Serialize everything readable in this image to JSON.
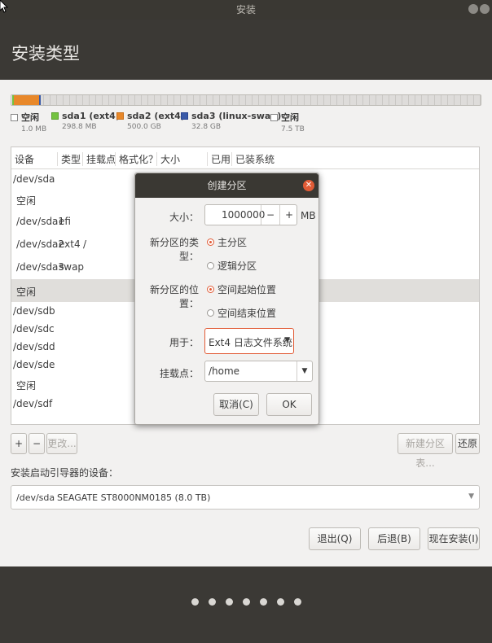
{
  "window": {
    "title": "安装"
  },
  "header": {
    "title": "安装类型"
  },
  "partitions": {
    "legend": [
      {
        "name": "空闲",
        "size": "1.0 MB",
        "color": "#ffffff"
      },
      {
        "name": "sda1 (ext4)",
        "size": "298.8 MB",
        "color": "#73c23f"
      },
      {
        "name": "sda2 (ext4)",
        "size": "500.0 GB",
        "color": "#e8882a"
      },
      {
        "name": "sda3 (linux-swap)",
        "size": "32.8 GB",
        "color": "#3a5aa8"
      },
      {
        "name": "空闲",
        "size": "7.5 TB",
        "color": "#ffffff"
      }
    ]
  },
  "table": {
    "headers": [
      "设备",
      "类型",
      "挂载点",
      "格式化？",
      "大小",
      "已用",
      "已装系统"
    ],
    "rows": [
      {
        "device": "/dev/sda",
        "type": "",
        "mount": ""
      },
      {
        "device": "空闲",
        "type": "",
        "mount": ""
      },
      {
        "device": "/dev/sda1",
        "type": "efi",
        "mount": ""
      },
      {
        "device": "/dev/sda2",
        "type": "ext4",
        "mount": "/"
      },
      {
        "device": "/dev/sda3",
        "type": "swap",
        "mount": ""
      },
      {
        "device": "空闲",
        "type": "",
        "mount": "",
        "selected": true
      },
      {
        "device": "/dev/sdb",
        "type": "",
        "mount": ""
      },
      {
        "device": "/dev/sdc",
        "type": "",
        "mount": ""
      },
      {
        "device": "/dev/sdd",
        "type": "",
        "mount": ""
      },
      {
        "device": "/dev/sde",
        "type": "",
        "mount": ""
      },
      {
        "device": "空闲",
        "type": "",
        "mount": ""
      },
      {
        "device": "/dev/sdf",
        "type": "",
        "mount": ""
      }
    ]
  },
  "toolbar": {
    "add": "+",
    "remove": "−",
    "change": "更改...",
    "new_table": "新建分区表...",
    "revert": "还原"
  },
  "boot": {
    "label": "安装启动引导器的设备：",
    "device": "/dev/sda",
    "model": "SEAGATE ST8000NM0185 (8.0 TB)"
  },
  "actions": {
    "quit": "退出(Q)",
    "back": "后退(B)",
    "install": "现在安装(I)"
  },
  "dialog": {
    "title": "创建分区",
    "size_label": "大小：",
    "size_value": "1000000",
    "minus": "−",
    "plus": "+",
    "unit": "MB",
    "type_label": "新分区的类型：",
    "type_primary": "主分区",
    "type_logical": "逻辑分区",
    "location_label": "新分区的位置：",
    "location_begin": "空间起始位置",
    "location_end": "空间结束位置",
    "use_label": "用于：",
    "use_value": "Ext4 日志文件系统",
    "mount_label": "挂载点：",
    "mount_value": "/home",
    "cancel": "取消(C)",
    "ok": "OK"
  },
  "progress": {
    "total_steps": 7
  }
}
